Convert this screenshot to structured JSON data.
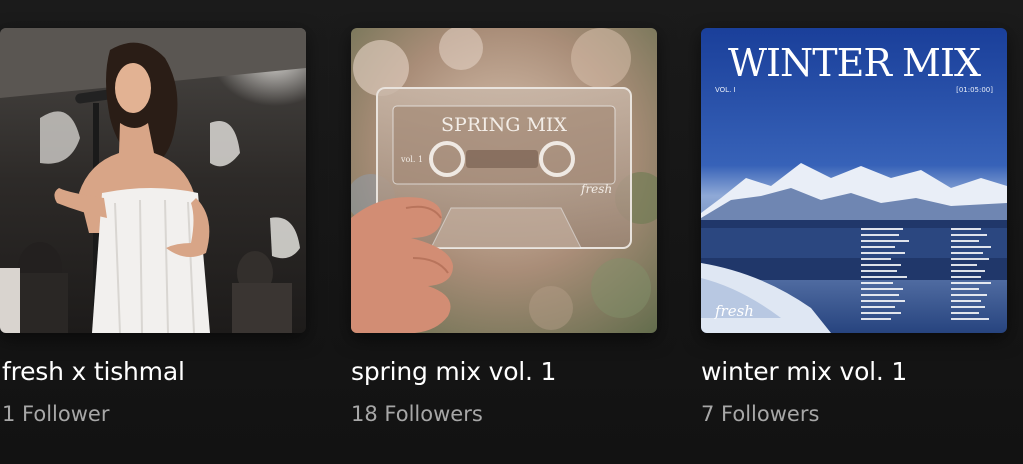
{
  "playlists": [
    {
      "title": "fresh x tishmal",
      "followers": "1 Follower",
      "cover": {
        "type": "photo",
        "subject": "singer-performing-at-microphone"
      }
    },
    {
      "title": "spring mix vol. 1",
      "followers": "18 Followers",
      "cover": {
        "type": "photo",
        "subject": "hand-holding-clear-cassette",
        "cassette_label": "SPRING MIX",
        "cassette_side": "vol. 1",
        "cassette_brand": "fresh"
      }
    },
    {
      "title": "winter mix vol. 1",
      "followers": "7 Followers",
      "cover": {
        "type": "album-art",
        "subject": "snowy-mountains-sea-of-clouds",
        "heading": "WINTER MIX",
        "volume": "VOL. I",
        "duration": "[01:05:00]",
        "brand": "fresh"
      }
    }
  ],
  "colors": {
    "background": "#121212",
    "title_text": "#ffffff",
    "subtitle_text": "#a7a7a7"
  }
}
